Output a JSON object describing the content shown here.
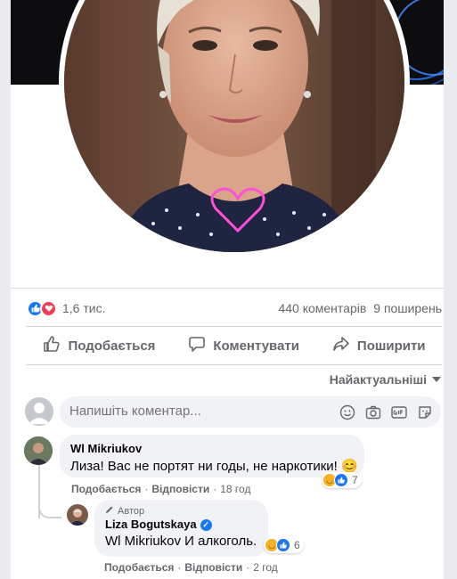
{
  "post": {
    "reaction_count": "1,6 тис.",
    "comments_count": "440 коментарів",
    "shares_count": "9 поширень"
  },
  "actions": {
    "like": "Подобається",
    "comment": "Коментувати",
    "share": "Поширити"
  },
  "sort": {
    "label": "Найактуальніші"
  },
  "composer": {
    "placeholder": "Напишіть коментар..."
  },
  "comments": [
    {
      "author": "Wl Mikriukov",
      "text": "Лиза! Вас не портят ни годы, не наркотики! 😊",
      "like_label": "Подобається",
      "reply_label": "Відповісти",
      "time": "18 год",
      "reactions_count": "7"
    },
    {
      "badge": "Автор",
      "author": "Liza Bogutskaya",
      "mention": "Wl Mikriukov",
      "text": "И алкоголь.",
      "like_label": "Подобається",
      "reply_label": "Відповісти",
      "time": "2 год",
      "reactions_count": "6"
    }
  ],
  "colors": {
    "accent": "#1877f2",
    "love": "#f33e58",
    "muted": "#65676b",
    "bubble": "#f0f2f5"
  }
}
